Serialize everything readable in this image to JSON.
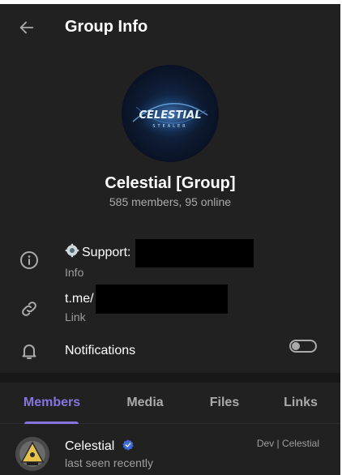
{
  "header": {
    "title": "Group Info",
    "back_icon": "arrow-left-icon"
  },
  "group": {
    "name": "Celestial [Group]",
    "subtitle": "585 members, 95 online",
    "avatar": {
      "text_main": "CELESTIAL",
      "text_sub": "STEALER"
    }
  },
  "info_rows": {
    "support": {
      "value": "Support:",
      "label": "Info",
      "icon": "info-icon",
      "prefix_icon": "gear-icon"
    },
    "link": {
      "value": "t.me/",
      "label": "Link",
      "icon": "link-icon"
    },
    "notifications": {
      "label": "Notifications",
      "icon": "bell-icon",
      "enabled": false
    }
  },
  "tabs": [
    {
      "label": "Members",
      "active": true
    },
    {
      "label": "Media",
      "active": false
    },
    {
      "label": "Files",
      "active": false
    },
    {
      "label": "Links",
      "active": false
    }
  ],
  "members": [
    {
      "name": "Celestial",
      "status": "last seen recently",
      "role": "Dev | Celestial",
      "verified_icon": "verified-badge-icon"
    }
  ],
  "colors": {
    "background": "#212121",
    "accent": "#8774e1",
    "muted": "#aaaaaa"
  }
}
